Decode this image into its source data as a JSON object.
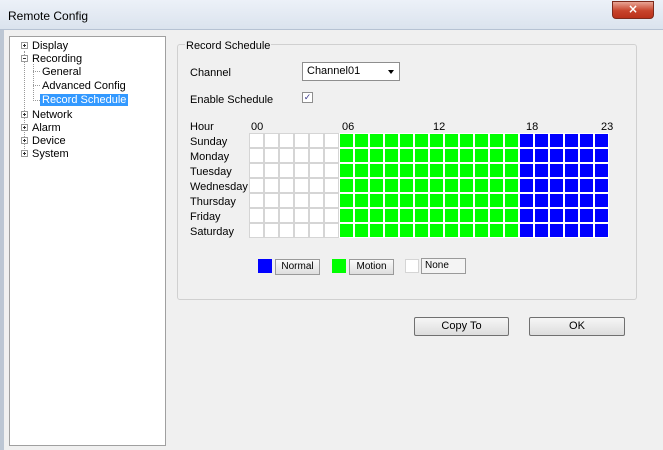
{
  "window": {
    "title": "Remote Config",
    "close_glyph": "×"
  },
  "tree": {
    "items": [
      {
        "label": "Display"
      },
      {
        "label": "Recording"
      },
      {
        "label": "General"
      },
      {
        "label": "Advanced Config"
      },
      {
        "label": "Record Schedule",
        "selected": true
      },
      {
        "label": "Network"
      },
      {
        "label": "Alarm"
      },
      {
        "label": "Device"
      },
      {
        "label": "System"
      }
    ]
  },
  "panel": {
    "group_title": "Record Schedule",
    "channel_label": "Channel",
    "channel_value": "Channel01",
    "enable_label": "Enable Schedule",
    "enable_checked": true,
    "check_glyph": "✓"
  },
  "schedule": {
    "hour_label": "Hour",
    "hour_ticks": [
      "00",
      "06",
      "12",
      "18",
      "23"
    ],
    "days": [
      "Sunday",
      "Monday",
      "Tuesday",
      "Wednesday",
      "Thursday",
      "Friday",
      "Saturday"
    ],
    "hour_types": [
      "none",
      "none",
      "none",
      "none",
      "none",
      "none",
      "motion",
      "motion",
      "motion",
      "motion",
      "motion",
      "motion",
      "motion",
      "motion",
      "motion",
      "motion",
      "motion",
      "motion",
      "normal",
      "normal",
      "normal",
      "normal",
      "normal",
      "normal"
    ],
    "colors": {
      "normal": "#0000ff",
      "motion": "#00ff00",
      "none": "#ffffff"
    }
  },
  "legend": {
    "normal_label": "Normal",
    "motion_label": "Motion",
    "none_label": "None"
  },
  "buttons": {
    "copy_to": "Copy To",
    "ok": "OK"
  }
}
